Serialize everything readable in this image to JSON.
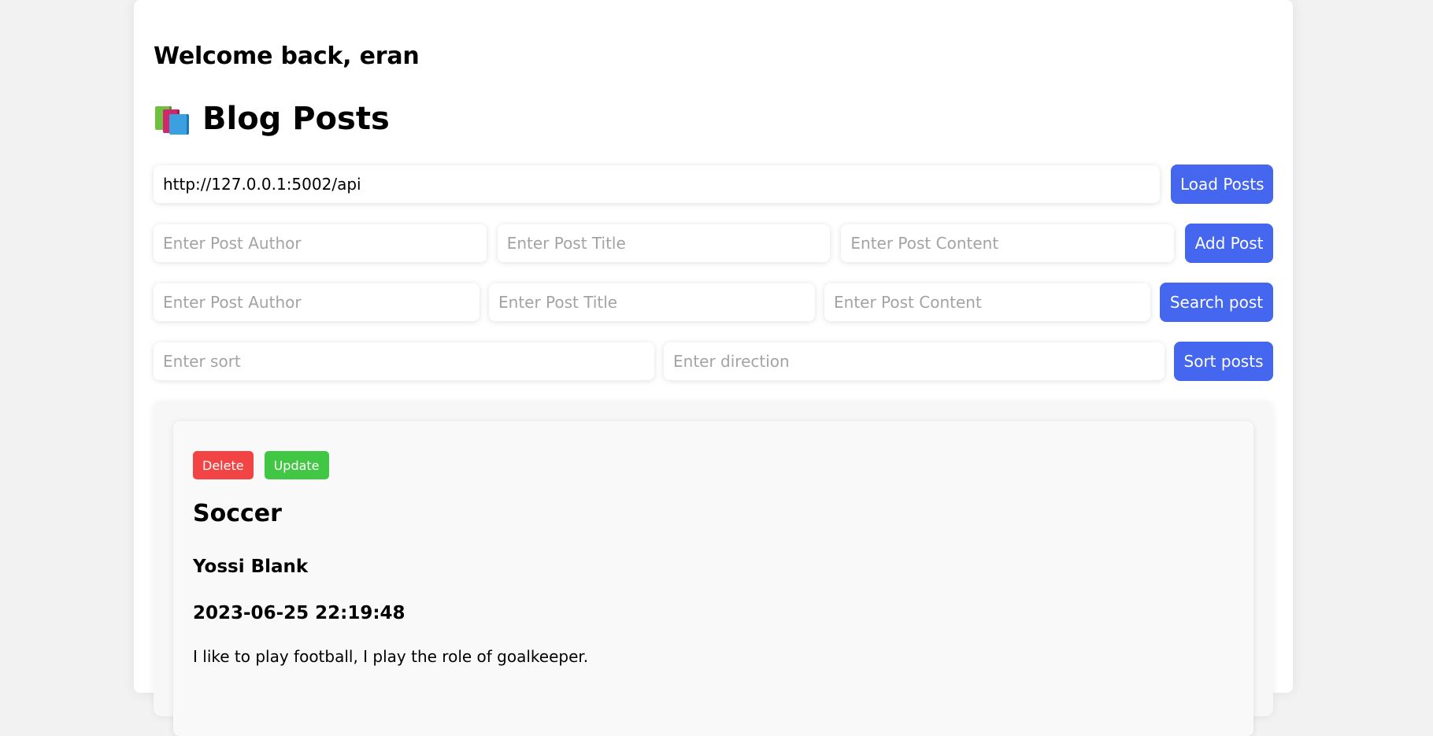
{
  "header": {
    "welcome": "Welcome back, eran",
    "title": "Blog Posts",
    "title_icon": "books-icon"
  },
  "api": {
    "url": "http://127.0.0.1:5002/api",
    "load_label": "Load Posts"
  },
  "add_form": {
    "author_placeholder": "Enter Post Author",
    "title_placeholder": "Enter Post Title",
    "content_placeholder": "Enter Post Content",
    "button_label": "Add Post"
  },
  "search_form": {
    "author_placeholder": "Enter Post Author",
    "title_placeholder": "Enter Post Title",
    "content_placeholder": "Enter Post Content",
    "button_label": "Search post"
  },
  "sort_form": {
    "sort_placeholder": "Enter sort",
    "direction_placeholder": "Enter direction",
    "button_label": "Sort posts"
  },
  "posts": [
    {
      "delete_label": "Delete",
      "update_label": "Update",
      "title": "Soccer",
      "author": "Yossi Blank",
      "date": "2023-06-25 22:19:48",
      "content": "I like to play football, I play the role of goalkeeper."
    }
  ],
  "colors": {
    "primary_button": "#4566ee",
    "delete_button": "#f24444",
    "update_button": "#41c744",
    "background": "#f2f2f2"
  }
}
